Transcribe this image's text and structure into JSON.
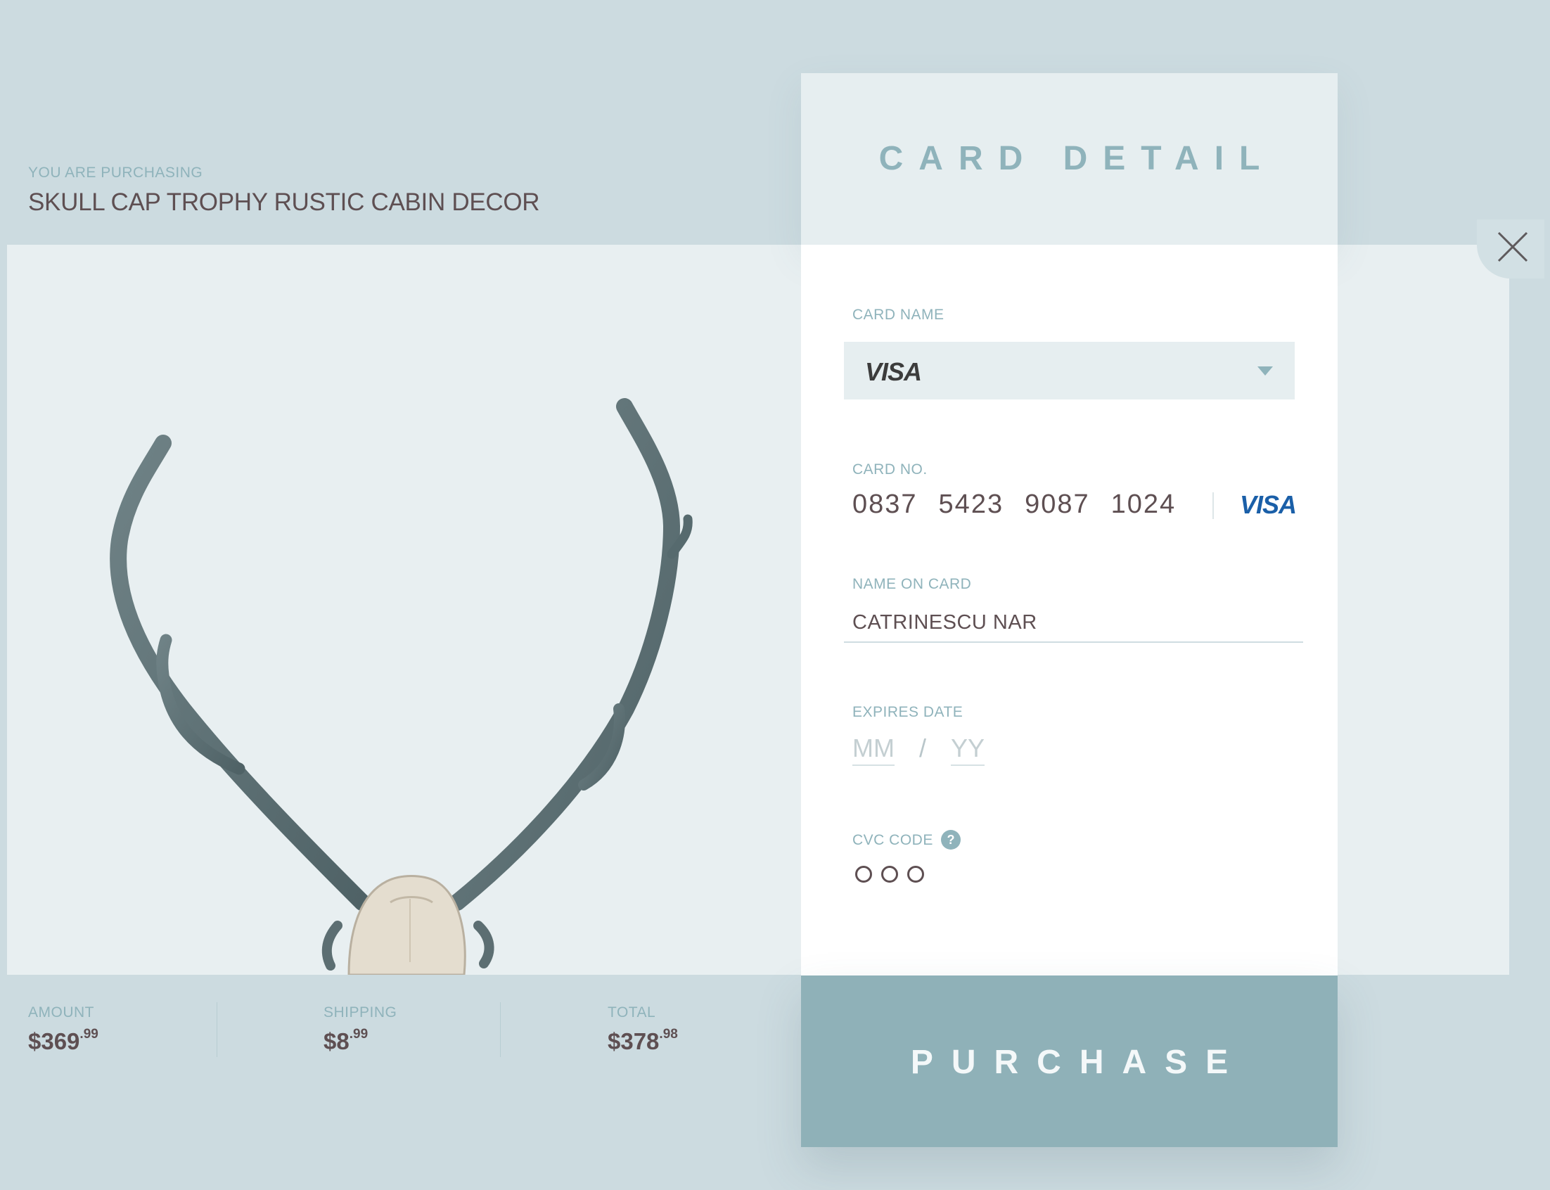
{
  "purchase": {
    "label": "YOU ARE PURCHASING",
    "product_title": "SKULL CAP TROPHY RUSTIC CABIN DECOR"
  },
  "card_detail": {
    "title": "CARD DETAIL",
    "card_name": {
      "label": "CARD NAME",
      "selected": "VISA"
    },
    "card_number": {
      "label": "CARD NO.",
      "groups": [
        "0837",
        "5423",
        "9087",
        "1024"
      ],
      "brand": "VISA"
    },
    "name_on_card": {
      "label": "NAME ON CARD",
      "value": "CATRINESCU NAR"
    },
    "expires": {
      "label": "EXPIRES DATE",
      "month_placeholder": "MM",
      "separator": "/",
      "year_placeholder": "YY"
    },
    "cvc": {
      "label": "CVC CODE",
      "help": "?"
    }
  },
  "purchase_button": {
    "label": "PURCHASE"
  },
  "summary": {
    "amount": {
      "label": "AMOUNT",
      "dollars": "$369",
      "cents": ".99"
    },
    "shipping": {
      "label": "SHIPPING",
      "dollars": "$8",
      "cents": ".99"
    },
    "total": {
      "label": "TOTAL",
      "dollars": "$378",
      "cents": ".98"
    }
  },
  "colors": {
    "background": "#ccdbe0",
    "accent": "#8fb3bb",
    "text_dark": "#5e4f52",
    "visa_blue": "#1a5fa8"
  },
  "icons": {
    "close": "close-icon",
    "dropdown": "chevron-down-icon",
    "help": "help-icon"
  }
}
